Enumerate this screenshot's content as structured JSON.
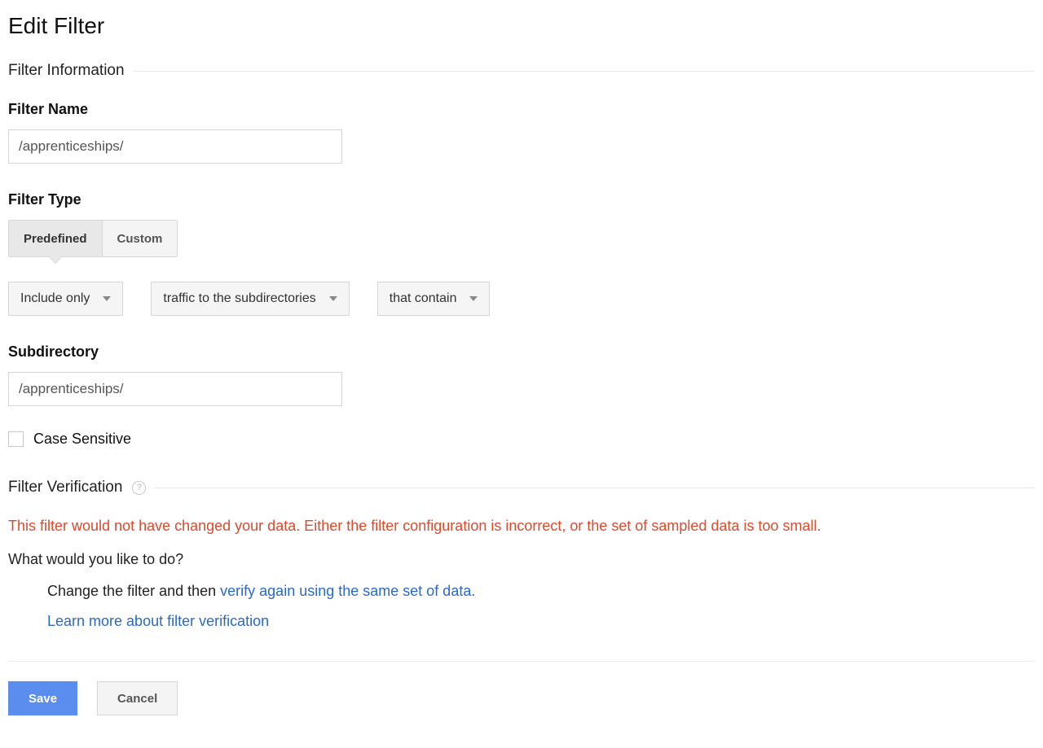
{
  "page_title": "Edit Filter",
  "section_info_title": "Filter Information",
  "filter_name": {
    "label": "Filter Name",
    "value": "/apprenticeships/"
  },
  "filter_type": {
    "label": "Filter Type",
    "toggle": {
      "predefined": "Predefined",
      "custom": "Custom",
      "active": "predefined"
    },
    "dd1": "Include only",
    "dd2": "traffic to the subdirectories",
    "dd3": "that contain"
  },
  "subdirectory": {
    "label": "Subdirectory",
    "value": "/apprenticeships/"
  },
  "case_sensitive_label": "Case Sensitive",
  "verification": {
    "title": "Filter Verification",
    "warning": "This filter would not have changed your data. Either the filter configuration is incorrect, or the set of sampled data is too small.",
    "prompt": "What would you like to do?",
    "option1_prefix": "Change the filter and then ",
    "option1_link": "verify again using the same set of data.",
    "option2_link": "Learn more about filter verification"
  },
  "actions": {
    "save": "Save",
    "cancel": "Cancel"
  }
}
